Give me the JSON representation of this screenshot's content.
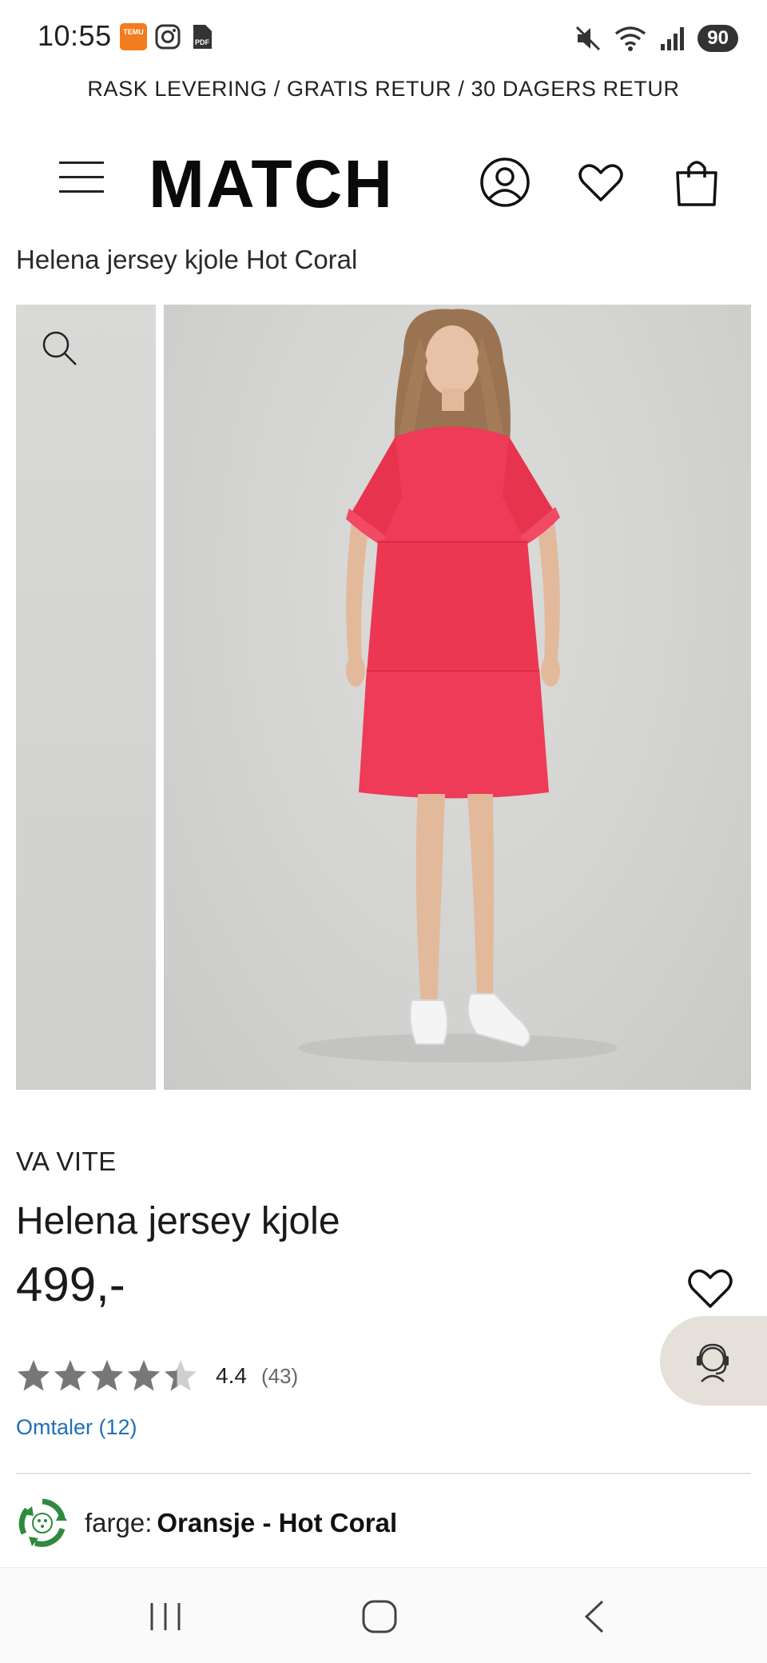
{
  "status_bar": {
    "time": "10:55",
    "temu_label": "TEMU",
    "pdf_label": "PDF",
    "battery": "90",
    "icons": [
      "temu-app-icon",
      "instagram-icon",
      "pdf-icon",
      "mute-icon",
      "wifi-icon",
      "signal-icon",
      "battery-icon"
    ]
  },
  "promo": {
    "text": "RASK LEVERING / GRATIS RETUR / 30 DAGERS RETUR"
  },
  "header": {
    "logo": "MATCH",
    "icons": [
      "menu-icon",
      "user-icon",
      "heart-icon",
      "bag-icon"
    ]
  },
  "breadcrumb": {
    "title": "Helena jersey kjole Hot Coral"
  },
  "product": {
    "brand": "VA VITE",
    "name": "Helena jersey kjole",
    "price": "499,-",
    "rating": {
      "value_label": "4.4",
      "value": 4.4,
      "max": 5,
      "count_label": "(43)"
    },
    "reviews_link": "Omtaler (12)",
    "color_label": "farge:",
    "color_value": "Oransje - Hot Coral"
  },
  "colors": {
    "dress": "#ee3b57",
    "star": "#777777",
    "link": "#1f6fb8",
    "support_bg": "#e6e0db",
    "eco_green": "#2e8a3e"
  }
}
